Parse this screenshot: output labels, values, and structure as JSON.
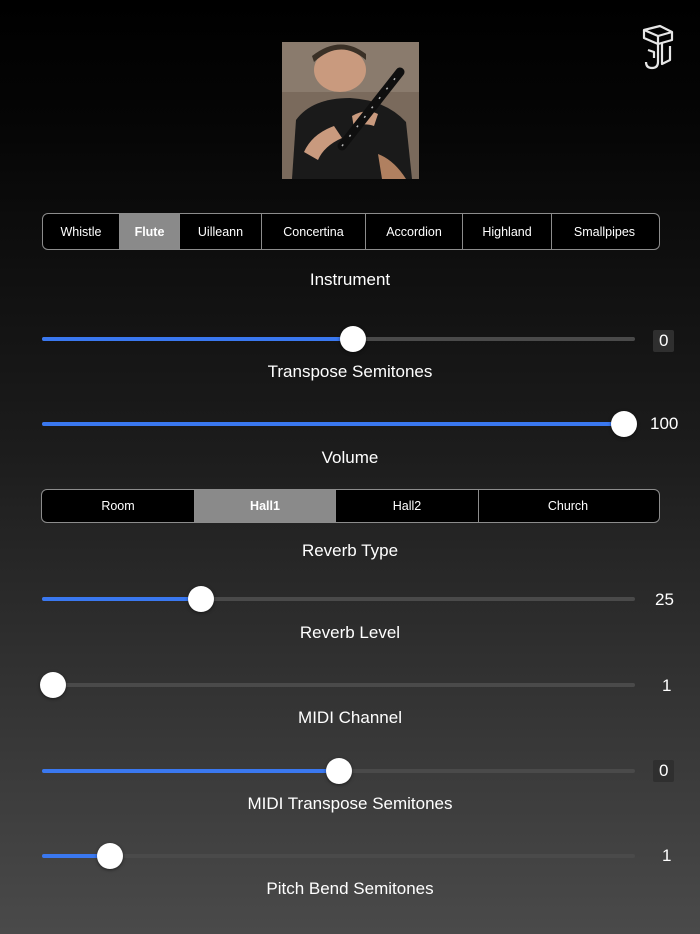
{
  "instrument_options": [
    "Whistle",
    "Flute",
    "Uilleann",
    "Concertina",
    "Accordion",
    "Highland",
    "Smallpipes"
  ],
  "instrument_selected": "Flute",
  "instrument_label": "Instrument",
  "transpose": {
    "label": "Transpose Semitones",
    "value": "0",
    "level": 0.526
  },
  "volume": {
    "label": "Volume",
    "value": "100",
    "level": 1.0
  },
  "reverb_options": [
    "Room",
    "Hall1",
    "Hall2",
    "Church"
  ],
  "reverb_selected": "Hall1",
  "reverb_type_label": "Reverb Type",
  "reverb_level": {
    "label": "Reverb Level",
    "value": "25",
    "level": 0.26
  },
  "midi_channel": {
    "label": "MIDI Channel",
    "value": "1",
    "level": 0.0
  },
  "midi_transpose": {
    "label": "MIDI Transpose Semitones",
    "value": "0",
    "level": 0.5
  },
  "pitch_bend": {
    "label": "Pitch Bend Semitones",
    "value": "1",
    "level": 0.1
  },
  "colors": {
    "accent": "#3a78f0",
    "selected_segment": "#8a8a8a",
    "track": "#4a4a4a"
  },
  "icons": {
    "logo": "app-logo-icon",
    "photo": "instrument-photo"
  }
}
